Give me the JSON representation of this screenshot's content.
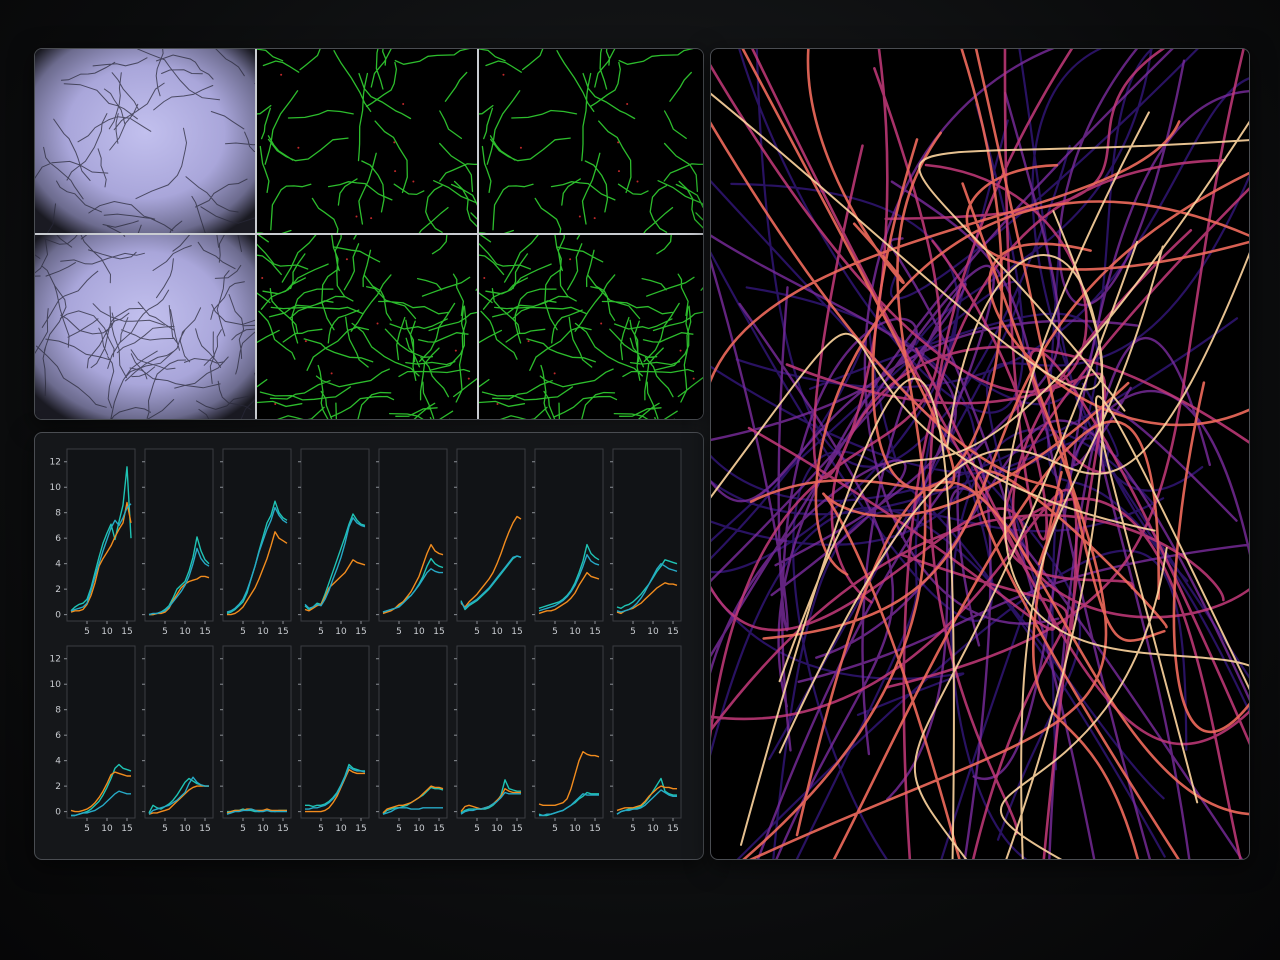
{
  "colors": {
    "series": [
      "#1fc4b4",
      "#f28c1e",
      "#27a9c6"
    ],
    "axes_frame": "#3a3d42",
    "panel_bg": "#15171a",
    "brightfield": "#b4b0e0",
    "fluorescence": "#32d232"
  },
  "micrographs": {
    "layout": "2 rows x 3 columns",
    "columns": [
      "brightfield",
      "green-fluorescence",
      "green-fluorescence"
    ]
  },
  "network_image": {
    "colormap": [
      "#3a1a8c",
      "#7a2c9e",
      "#c43a7a",
      "#f06a5c",
      "#ffd6a0"
    ]
  },
  "chart_data": {
    "type": "line",
    "layout": "2 rows x 8 columns of small multiples, shared axes",
    "xlim": [
      0,
      17
    ],
    "ylim": [
      -0.5,
      13
    ],
    "xticks": [
      5,
      10,
      15
    ],
    "yticks": [
      0,
      2,
      4,
      6,
      8,
      10,
      12
    ],
    "x": [
      1,
      2,
      3,
      4,
      5,
      6,
      7,
      8,
      9,
      10,
      11,
      12,
      13,
      14,
      15,
      16
    ],
    "panels": [
      {
        "series": [
          {
            "values": [
              0.3,
              0.6,
              0.8,
              0.9,
              1.2,
              2.1,
              3.3,
              4.5,
              5.6,
              6.4,
              7.1,
              5.9,
              7.3,
              8.6,
              11.6,
              6.0
            ]
          },
          {
            "values": [
              0.2,
              0.3,
              0.3,
              0.4,
              0.8,
              1.5,
              2.5,
              3.8,
              4.4,
              4.9,
              5.4,
              6.1,
              6.7,
              7.2,
              8.8,
              7.2
            ]
          },
          {
            "values": [
              0.3,
              0.4,
              0.5,
              0.6,
              0.9,
              1.9,
              3.0,
              4.0,
              5.0,
              5.9,
              6.8,
              7.4,
              7.0,
              7.6,
              8.4,
              8.7
            ]
          }
        ]
      },
      {
        "series": [
          {
            "values": [
              0.0,
              0.0,
              0.1,
              0.2,
              0.4,
              0.7,
              1.3,
              2.0,
              2.3,
              2.6,
              3.4,
              4.5,
              6.1,
              5.0,
              4.3,
              4.0
            ]
          },
          {
            "values": [
              0.0,
              0.0,
              0.1,
              0.1,
              0.2,
              0.5,
              1.1,
              1.6,
              2.1,
              2.4,
              2.6,
              2.7,
              2.8,
              3.0,
              3.0,
              2.9
            ]
          },
          {
            "values": [
              0.0,
              0.1,
              0.1,
              0.2,
              0.3,
              0.6,
              1.0,
              1.4,
              1.8,
              2.3,
              3.0,
              4.0,
              5.2,
              4.4,
              4.0,
              3.8
            ]
          }
        ]
      },
      {
        "series": [
          {
            "values": [
              0.1,
              0.2,
              0.4,
              0.7,
              1.0,
              1.7,
              2.8,
              3.8,
              5.0,
              6.1,
              7.2,
              7.8,
              8.9,
              8.0,
              7.6,
              7.4
            ]
          },
          {
            "values": [
              0.0,
              0.0,
              0.1,
              0.3,
              0.6,
              1.1,
              1.6,
              2.1,
              2.8,
              3.6,
              4.4,
              5.4,
              6.5,
              6.0,
              5.8,
              5.6
            ]
          },
          {
            "values": [
              0.2,
              0.3,
              0.5,
              0.8,
              1.2,
              1.9,
              2.8,
              3.8,
              4.9,
              5.8,
              6.7,
              7.4,
              8.4,
              7.8,
              7.4,
              7.2
            ]
          }
        ]
      },
      {
        "series": [
          {
            "values": [
              0.7,
              0.4,
              0.6,
              0.9,
              0.8,
              1.6,
              2.5,
              3.4,
              4.3,
              5.2,
              6.1,
              7.1,
              7.9,
              7.4,
              7.1,
              7.0
            ]
          },
          {
            "values": [
              0.4,
              0.3,
              0.5,
              0.7,
              0.8,
              1.4,
              2.1,
              2.4,
              2.7,
              3.0,
              3.3,
              3.8,
              4.3,
              4.1,
              4.0,
              3.9
            ]
          },
          {
            "values": [
              0.8,
              0.5,
              0.6,
              0.8,
              0.7,
              1.2,
              1.9,
              2.8,
              3.6,
              4.5,
              5.6,
              6.9,
              7.6,
              7.2,
              7.0,
              6.9
            ]
          }
        ]
      },
      {
        "series": [
          {
            "values": [
              0.2,
              0.3,
              0.4,
              0.5,
              0.7,
              1.0,
              1.3,
              1.5,
              1.9,
              2.4,
              3.0,
              3.8,
              4.4,
              4.0,
              3.8,
              3.7
            ]
          },
          {
            "values": [
              0.1,
              0.2,
              0.3,
              0.5,
              0.8,
              1.0,
              1.4,
              1.8,
              2.4,
              3.0,
              3.9,
              4.8,
              5.5,
              5.0,
              4.8,
              4.7
            ]
          },
          {
            "values": [
              0.2,
              0.3,
              0.4,
              0.5,
              0.6,
              0.9,
              1.2,
              1.5,
              1.9,
              2.3,
              2.8,
              3.3,
              3.6,
              3.4,
              3.3,
              3.3
            ]
          }
        ]
      },
      {
        "series": [
          {
            "values": [
              1.1,
              0.4,
              0.7,
              0.9,
              1.1,
              1.4,
              1.7,
              2.0,
              2.4,
              2.8,
              3.2,
              3.6,
              4.0,
              4.4,
              4.6,
              4.5
            ]
          },
          {
            "values": [
              0.9,
              0.6,
              1.0,
              1.3,
              1.6,
              2.0,
              2.4,
              2.8,
              3.3,
              4.0,
              4.8,
              5.7,
              6.5,
              7.2,
              7.7,
              7.5
            ]
          },
          {
            "values": [
              1.0,
              0.5,
              0.8,
              1.0,
              1.2,
              1.5,
              1.8,
              2.1,
              2.5,
              2.9,
              3.3,
              3.7,
              4.1,
              4.5,
              4.6,
              4.5
            ]
          }
        ]
      },
      {
        "series": [
          {
            "values": [
              0.5,
              0.6,
              0.7,
              0.8,
              0.9,
              1.0,
              1.2,
              1.5,
              1.9,
              2.5,
              3.3,
              4.2,
              5.5,
              4.8,
              4.5,
              4.3
            ]
          },
          {
            "values": [
              0.1,
              0.2,
              0.3,
              0.3,
              0.4,
              0.6,
              0.8,
              1.0,
              1.3,
              1.7,
              2.3,
              2.8,
              3.3,
              3.0,
              2.9,
              2.8
            ]
          },
          {
            "values": [
              0.3,
              0.4,
              0.5,
              0.6,
              0.7,
              0.9,
              1.1,
              1.4,
              1.8,
              2.3,
              3.0,
              3.8,
              4.7,
              4.2,
              4.0,
              3.9
            ]
          }
        ]
      },
      {
        "series": [
          {
            "values": [
              0.6,
              0.5,
              0.7,
              0.8,
              1.0,
              1.3,
              1.6,
              2.0,
              2.4,
              2.9,
              3.4,
              3.8,
              4.3,
              4.2,
              4.1,
              4.0
            ]
          },
          {
            "values": [
              0.2,
              0.1,
              0.3,
              0.4,
              0.5,
              0.7,
              0.9,
              1.2,
              1.5,
              1.8,
              2.1,
              2.3,
              2.5,
              2.4,
              2.4,
              2.3
            ]
          },
          {
            "values": [
              0.3,
              0.2,
              0.3,
              0.4,
              0.6,
              0.9,
              1.3,
              1.8,
              2.4,
              3.0,
              3.6,
              4.0,
              3.8,
              3.6,
              3.5,
              3.4
            ]
          }
        ]
      },
      {
        "series": [
          {
            "values": [
              -0.3,
              -0.3,
              -0.2,
              -0.1,
              0.0,
              0.2,
              0.5,
              0.8,
              1.3,
              1.9,
              2.6,
              3.4,
              3.7,
              3.4,
              3.3,
              3.2
            ]
          },
          {
            "values": [
              0.1,
              0.0,
              0.0,
              0.1,
              0.2,
              0.4,
              0.7,
              1.1,
              1.6,
              2.2,
              2.9,
              3.1,
              3.0,
              2.9,
              2.8,
              2.8
            ]
          },
          {
            "values": [
              -0.3,
              -0.3,
              -0.2,
              -0.1,
              -0.1,
              0.0,
              0.1,
              0.3,
              0.5,
              0.8,
              1.1,
              1.4,
              1.6,
              1.5,
              1.4,
              1.4
            ]
          }
        ]
      },
      {
        "series": [
          {
            "values": [
              -0.1,
              0.5,
              0.3,
              0.2,
              0.4,
              0.6,
              0.9,
              1.3,
              1.8,
              2.3,
              2.6,
              2.4,
              2.2,
              2.1,
              2.0,
              2.0
            ]
          },
          {
            "values": [
              -0.2,
              -0.1,
              -0.1,
              0.0,
              0.1,
              0.2,
              0.5,
              0.8,
              1.1,
              1.4,
              1.7,
              1.9,
              2.0,
              2.0,
              2.0,
              2.0
            ]
          },
          {
            "values": [
              -0.2,
              0.1,
              0.2,
              0.3,
              0.4,
              0.5,
              0.7,
              0.9,
              1.2,
              1.5,
              2.2,
              2.7,
              2.3,
              2.1,
              2.0,
              2.0
            ]
          }
        ]
      },
      {
        "series": [
          {
            "values": [
              0.0,
              0.0,
              0.1,
              0.1,
              0.2,
              0.1,
              0.1,
              0.0,
              0.0,
              0.1,
              0.1,
              0.1,
              0.0,
              0.1,
              0.1,
              0.1
            ]
          },
          {
            "values": [
              -0.1,
              0.0,
              0.1,
              0.1,
              0.1,
              0.2,
              0.2,
              0.1,
              0.1,
              0.1,
              0.2,
              0.1,
              0.1,
              0.1,
              0.1,
              0.1
            ]
          },
          {
            "values": [
              -0.2,
              -0.1,
              0.0,
              0.0,
              0.1,
              0.1,
              0.2,
              0.1,
              0.0,
              0.0,
              0.1,
              0.0,
              0.0,
              0.0,
              0.0,
              0.0
            ]
          }
        ]
      },
      {
        "series": [
          {
            "values": [
              0.5,
              0.5,
              0.4,
              0.5,
              0.5,
              0.6,
              0.8,
              1.1,
              1.5,
              2.1,
              2.8,
              3.7,
              3.4,
              3.3,
              3.2,
              3.2
            ]
          },
          {
            "values": [
              0.0,
              0.0,
              0.0,
              0.0,
              0.0,
              0.1,
              0.3,
              0.7,
              1.2,
              1.9,
              2.6,
              3.3,
              3.1,
              3.0,
              3.0,
              3.0
            ]
          },
          {
            "values": [
              0.2,
              0.2,
              0.3,
              0.3,
              0.4,
              0.5,
              0.7,
              1.0,
              1.4,
              2.0,
              2.7,
              3.5,
              3.3,
              3.2,
              3.2,
              3.1
            ]
          }
        ]
      },
      {
        "series": [
          {
            "values": [
              -0.2,
              0.1,
              0.2,
              0.3,
              0.3,
              0.4,
              0.5,
              0.7,
              0.9,
              1.1,
              1.3,
              1.6,
              1.9,
              1.8,
              1.8,
              1.7
            ]
          },
          {
            "values": [
              -0.1,
              0.2,
              0.3,
              0.4,
              0.5,
              0.5,
              0.6,
              0.7,
              0.9,
              1.1,
              1.4,
              1.7,
              2.0,
              1.9,
              1.9,
              1.8
            ]
          },
          {
            "values": [
              -0.2,
              -0.1,
              0.0,
              0.2,
              0.3,
              0.3,
              0.3,
              0.2,
              0.2,
              0.2,
              0.3,
              0.3,
              0.3,
              0.3,
              0.3,
              0.3
            ]
          }
        ]
      },
      {
        "series": [
          {
            "values": [
              -0.1,
              0.1,
              0.2,
              0.2,
              0.2,
              0.2,
              0.2,
              0.3,
              0.5,
              0.8,
              1.3,
              2.5,
              1.8,
              1.7,
              1.6,
              1.6
            ]
          },
          {
            "values": [
              0.0,
              0.4,
              0.5,
              0.4,
              0.3,
              0.2,
              0.3,
              0.4,
              0.6,
              0.9,
              1.2,
              1.8,
              1.6,
              1.5,
              1.5,
              1.5
            ]
          },
          {
            "values": [
              -0.2,
              0.0,
              0.1,
              0.1,
              0.2,
              0.2,
              0.3,
              0.4,
              0.6,
              0.8,
              1.1,
              1.5,
              1.4,
              1.4,
              1.4,
              1.4
            ]
          }
        ]
      },
      {
        "series": [
          {
            "values": [
              -0.2,
              -0.3,
              -0.3,
              -0.2,
              -0.1,
              0.0,
              0.1,
              0.3,
              0.5,
              0.7,
              1.0,
              1.2,
              1.5,
              1.4,
              1.4,
              1.4
            ]
          },
          {
            "values": [
              0.6,
              0.5,
              0.5,
              0.5,
              0.5,
              0.6,
              0.7,
              1.0,
              1.8,
              2.9,
              4.0,
              4.7,
              4.5,
              4.4,
              4.4,
              4.3
            ]
          },
          {
            "values": [
              -0.3,
              -0.3,
              -0.2,
              -0.2,
              -0.1,
              0.0,
              0.1,
              0.3,
              0.5,
              0.8,
              1.1,
              1.4,
              1.3,
              1.3,
              1.3,
              1.3
            ]
          }
        ]
      },
      {
        "series": [
          {
            "values": [
              -0.2,
              0.0,
              0.1,
              0.2,
              0.2,
              0.3,
              0.4,
              0.7,
              1.1,
              1.6,
              2.1,
              2.6,
              1.6,
              1.4,
              1.3,
              1.3
            ]
          },
          {
            "values": [
              0.1,
              0.2,
              0.3,
              0.3,
              0.3,
              0.4,
              0.5,
              0.8,
              1.2,
              1.5,
              1.8,
              2.0,
              1.9,
              1.9,
              1.8,
              1.8
            ]
          },
          {
            "values": [
              -0.2,
              0.0,
              0.1,
              0.1,
              0.2,
              0.2,
              0.3,
              0.5,
              0.8,
              1.1,
              1.4,
              1.7,
              1.5,
              1.3,
              1.2,
              1.2
            ]
          }
        ]
      }
    ]
  }
}
